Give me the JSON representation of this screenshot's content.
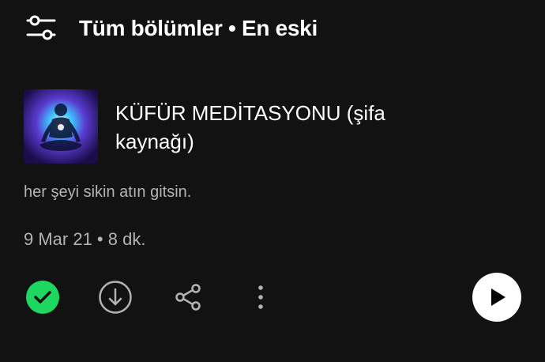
{
  "filter": {
    "icon": "sliders-icon",
    "label": "Tüm bölümler • En eski"
  },
  "episode": {
    "cover_icon": "meditation-cover-image",
    "title": "KÜFÜR MEDİTASYONU (şifa kaynağı)",
    "description": "her şeyi sikin atın gitsin.",
    "meta": "9 Mar 21 • 8 dk.",
    "accent": "#1ed760"
  },
  "actions": {
    "played_icon": "check-circle-icon",
    "download_icon": "download-icon",
    "share_icon": "share-icon",
    "more_icon": "more-vertical-icon",
    "play_icon": "play-icon"
  }
}
